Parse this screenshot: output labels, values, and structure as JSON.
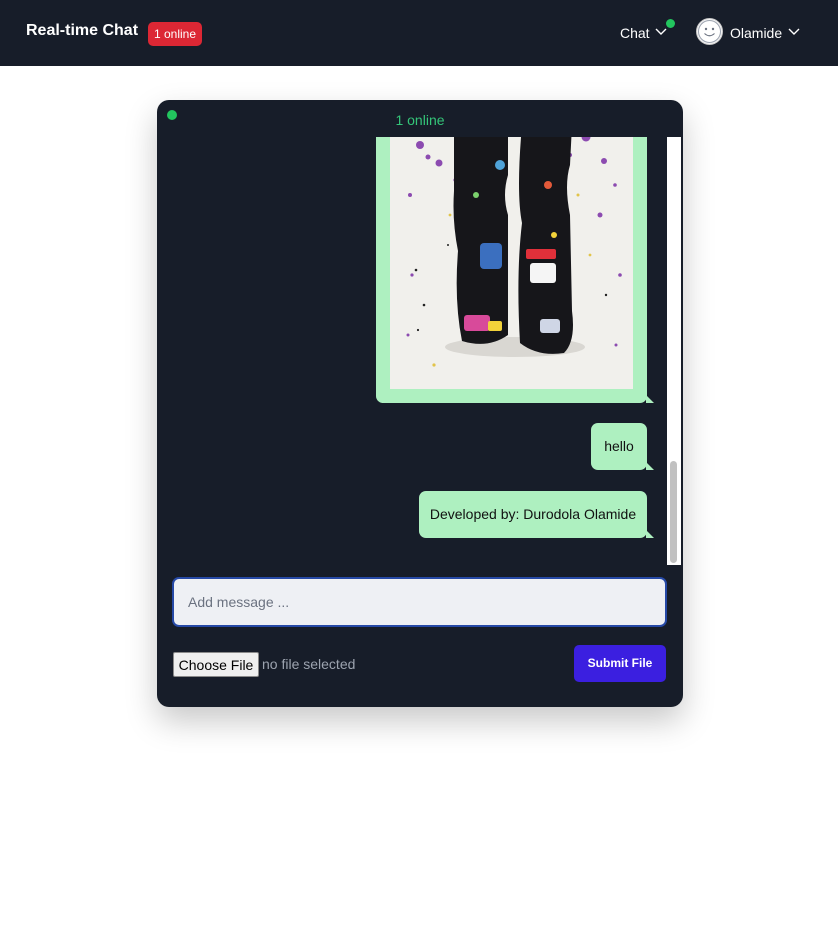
{
  "navbar": {
    "brand": "Real-time Chat",
    "online_badge": "1 online",
    "chat_menu_label": "Chat",
    "user_name": "Olamide"
  },
  "chat": {
    "online_status": "1 online",
    "messages": [
      {
        "type": "image",
        "description_icon": "figure-photo"
      },
      {
        "type": "text",
        "text": "hello"
      },
      {
        "type": "text",
        "text": "Developed by: Durodola Olamide"
      }
    ],
    "input": {
      "placeholder": "Add message ...",
      "value": ""
    },
    "file": {
      "choose_label": "Choose File",
      "status": "no file selected"
    },
    "submit_label": "Submit File"
  },
  "colors": {
    "navbar_bg": "#171d29",
    "badge_red": "#dc2734",
    "online_green": "#22c55e",
    "bubble_green": "#aef0c0",
    "submit_blue": "#3b1fe0"
  }
}
